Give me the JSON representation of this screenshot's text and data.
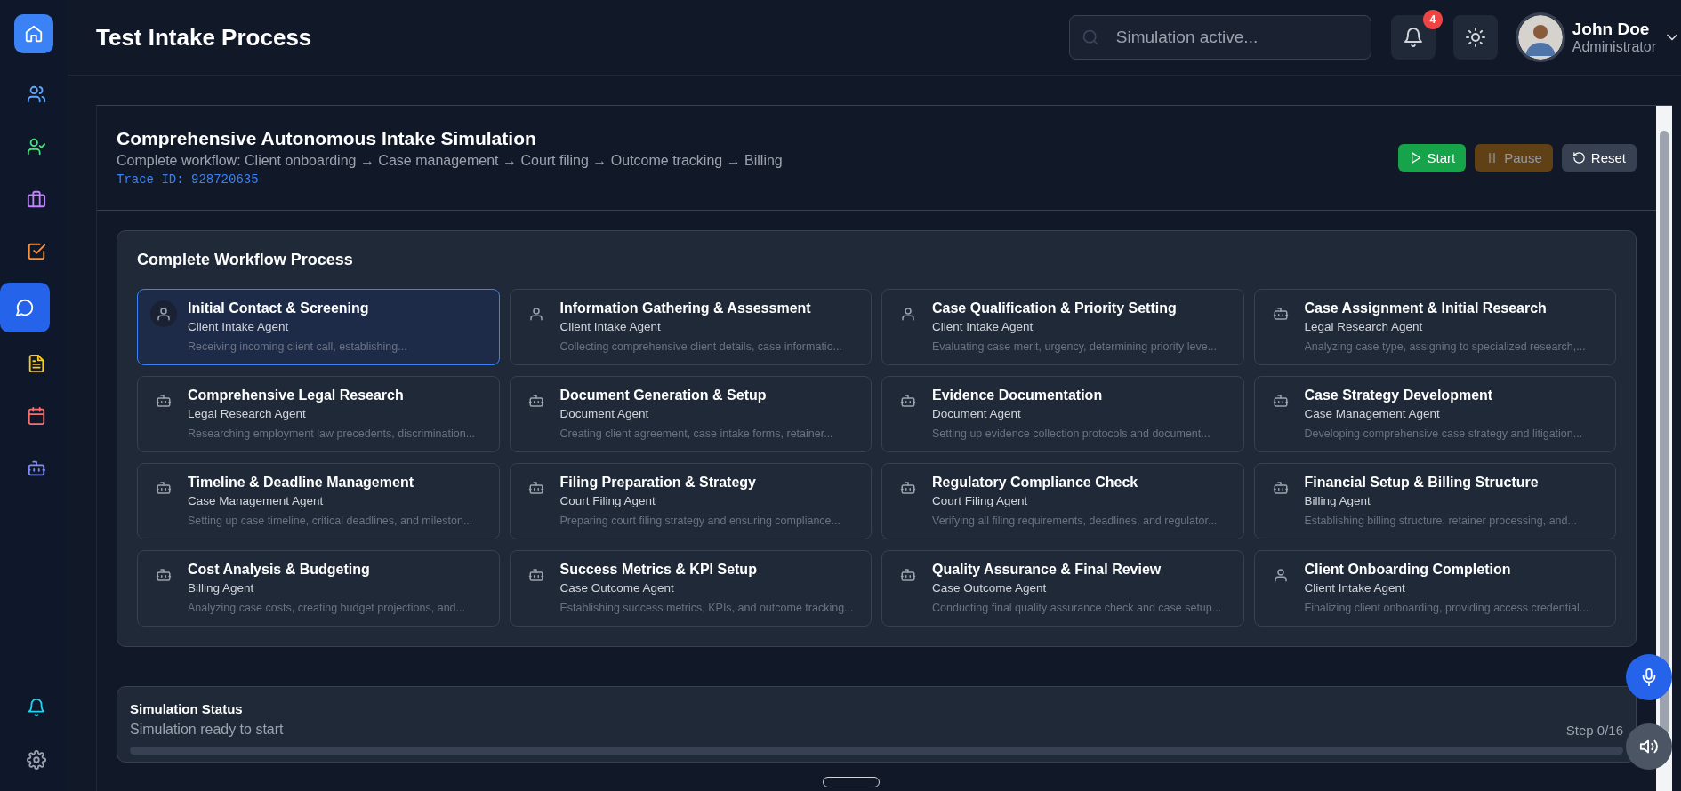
{
  "header": {
    "title": "Test Intake Process",
    "search": {
      "placeholder": "Simulation active..."
    },
    "notifications": {
      "count": "4"
    },
    "user": {
      "name": "John Doe",
      "role": "Administrator"
    }
  },
  "sidebar": {
    "items": [
      {
        "kind": "home",
        "selected": false
      },
      {
        "kind": "users",
        "selected": false
      },
      {
        "kind": "user-check",
        "selected": false
      },
      {
        "kind": "briefcase",
        "selected": false
      },
      {
        "kind": "task",
        "selected": false
      },
      {
        "kind": "chat",
        "selected": true
      },
      {
        "kind": "document",
        "selected": false
      },
      {
        "kind": "calendar",
        "selected": false
      },
      {
        "kind": "bot",
        "selected": false
      }
    ],
    "bottom_items": [
      {
        "kind": "bell"
      },
      {
        "kind": "settings"
      }
    ]
  },
  "simulation": {
    "title": "Comprehensive Autonomous Intake Simulation",
    "subtitle": "Complete workflow: Client onboarding → Case management → Court filing → Outcome tracking → Billing",
    "trace": "Trace ID: 928720635",
    "buttons": [
      {
        "kind": "start",
        "label": "Start",
        "disabled": false
      },
      {
        "kind": "pause",
        "label": "Pause",
        "disabled": true
      },
      {
        "kind": "reset",
        "label": "Reset",
        "disabled": false
      }
    ]
  },
  "workflow": {
    "title": "Complete Workflow Process",
    "steps": [
      {
        "kind": "person",
        "title": "Initial Contact & Screening",
        "agent": "Client Intake Agent",
        "description": "Receiving incoming client call, establishing...",
        "selected": true
      },
      {
        "kind": "person",
        "title": "Information Gathering & Assessment",
        "agent": "Client Intake Agent",
        "description": "Collecting comprehensive client details, case informatio...",
        "selected": false
      },
      {
        "kind": "person",
        "title": "Case Qualification & Priority Setting",
        "agent": "Client Intake Agent",
        "description": "Evaluating case merit, urgency, determining priority leve...",
        "selected": false
      },
      {
        "kind": "bot",
        "title": "Case Assignment & Initial Research",
        "agent": "Legal Research Agent",
        "description": "Analyzing case type, assigning to specialized research,...",
        "selected": false
      },
      {
        "kind": "bot",
        "title": "Comprehensive Legal Research",
        "agent": "Legal Research Agent",
        "description": "Researching employment law precedents, discrimination...",
        "selected": false
      },
      {
        "kind": "bot",
        "title": "Document Generation & Setup",
        "agent": "Document Agent",
        "description": "Creating client agreement, case intake forms, retainer...",
        "selected": false
      },
      {
        "kind": "bot",
        "title": "Evidence Documentation",
        "agent": "Document Agent",
        "description": "Setting up evidence collection protocols and document...",
        "selected": false
      },
      {
        "kind": "bot",
        "title": "Case Strategy Development",
        "agent": "Case Management Agent",
        "description": "Developing comprehensive case strategy and litigation...",
        "selected": false
      },
      {
        "kind": "bot",
        "title": "Timeline & Deadline Management",
        "agent": "Case Management Agent",
        "description": "Setting up case timeline, critical deadlines, and mileston...",
        "selected": false
      },
      {
        "kind": "bot",
        "title": "Filing Preparation & Strategy",
        "agent": "Court Filing Agent",
        "description": "Preparing court filing strategy and ensuring compliance...",
        "selected": false
      },
      {
        "kind": "bot",
        "title": "Regulatory Compliance Check",
        "agent": "Court Filing Agent",
        "description": "Verifying all filing requirements, deadlines, and regulator...",
        "selected": false
      },
      {
        "kind": "bot",
        "title": "Financial Setup & Billing Structure",
        "agent": "Billing Agent",
        "description": "Establishing billing structure, retainer processing, and...",
        "selected": false
      },
      {
        "kind": "bot",
        "title": "Cost Analysis & Budgeting",
        "agent": "Billing Agent",
        "description": "Analyzing case costs, creating budget projections, and...",
        "selected": false
      },
      {
        "kind": "bot",
        "title": "Success Metrics & KPI Setup",
        "agent": "Case Outcome Agent",
        "description": "Establishing success metrics, KPIs, and outcome tracking...",
        "selected": false
      },
      {
        "kind": "bot",
        "title": "Quality Assurance & Final Review",
        "agent": "Case Outcome Agent",
        "description": "Conducting final quality assurance check and case setup...",
        "selected": false
      },
      {
        "kind": "person",
        "title": "Client Onboarding Completion",
        "agent": "Client Intake Agent",
        "description": "Finalizing client onboarding, providing access credential...",
        "selected": false
      }
    ]
  },
  "status": {
    "title": "Simulation Status",
    "message": "Simulation ready to start",
    "step": "Step 0/16",
    "level": 0
  }
}
